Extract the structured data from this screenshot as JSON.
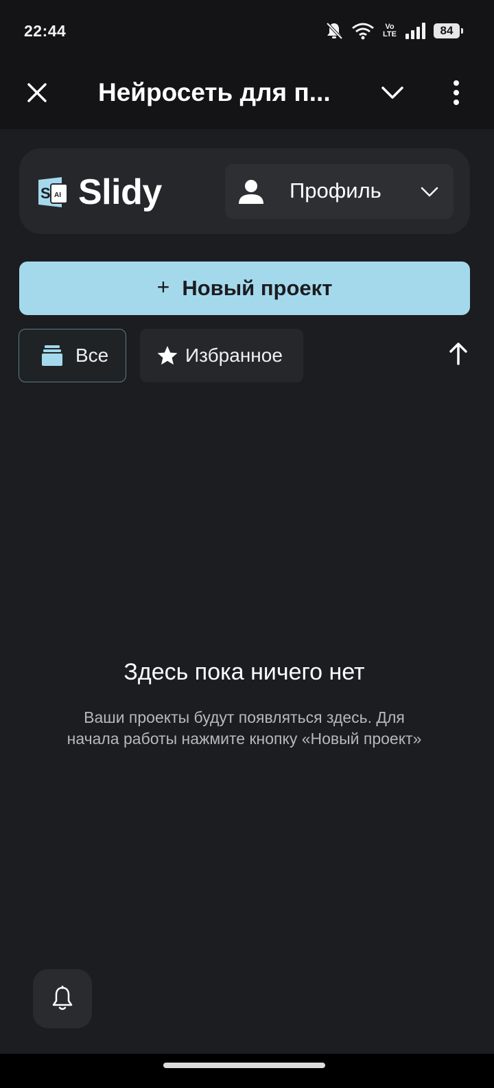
{
  "status_bar": {
    "time": "22:44",
    "volte_top": "Vo",
    "volte_bottom": "LTE",
    "battery": "84",
    "icons": [
      "bell-muted-icon",
      "wifi-icon",
      "volte-icon",
      "signal-icon",
      "battery-icon"
    ]
  },
  "top_bar": {
    "title": "Нейросеть для п...",
    "icons": [
      "close-icon",
      "chevron-down-icon",
      "more-vert-icon"
    ]
  },
  "header": {
    "logo_text": "Slidy",
    "logo_badge_s": "S",
    "logo_badge_ai": "AI",
    "profile_label": "Профиль"
  },
  "actions": {
    "new_project_plus": "+",
    "new_project_label": "Новый проект"
  },
  "filters": {
    "all_label": "Все",
    "favorites_label": "Избранное"
  },
  "empty_state": {
    "title": "Здесь пока ничего нет",
    "description": "Ваши проекты будут появляться здесь. Для начала работы нажмите кнопку «Новый проект»"
  },
  "colors": {
    "background": "#1c1d21",
    "card": "#26272b",
    "accent": "#a4d9ec",
    "bar": "#141416"
  }
}
